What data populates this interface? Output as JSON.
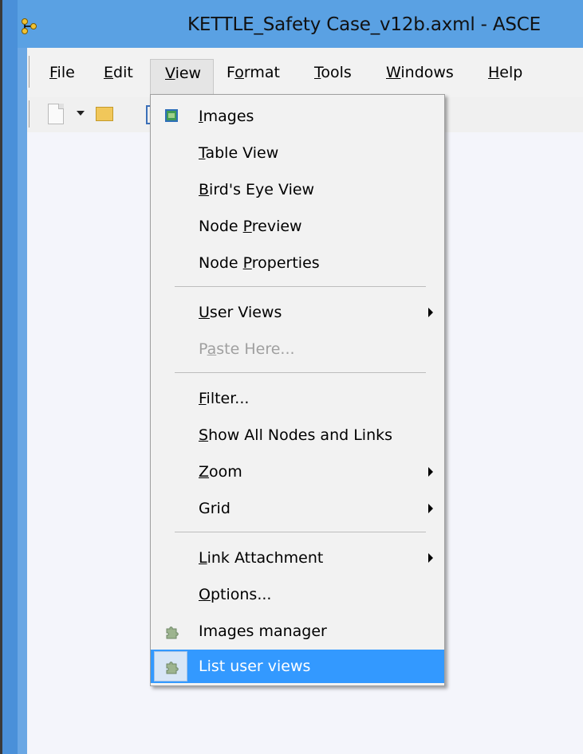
{
  "window": {
    "title": "KETTLE_Safety Case_v12b.axml - ASCE"
  },
  "menubar": {
    "items": [
      {
        "label": "File",
        "underline": "F",
        "rest": "ile"
      },
      {
        "label": "Edit",
        "underline": "E",
        "rest": "dit"
      },
      {
        "label": "View",
        "underline": "V",
        "rest": "iew",
        "active": true
      },
      {
        "label": "Format",
        "before": "F",
        "underline": "o",
        "rest": "rmat"
      },
      {
        "label": "Tools",
        "underline": "T",
        "rest": "ools"
      },
      {
        "label": "Windows",
        "underline": "W",
        "rest": "indows"
      },
      {
        "label": "Help",
        "underline": "H",
        "rest": "elp"
      }
    ]
  },
  "toolbar": {
    "icons": [
      "new-document-icon",
      "dropdown-arrow-icon",
      "open-folder-icon"
    ]
  },
  "view_menu": {
    "items": [
      {
        "label": "Images",
        "before": "",
        "u": "I",
        "after": "mages",
        "icon": "images-icon"
      },
      {
        "label": "Table View",
        "before": "",
        "u": "T",
        "after": "able View"
      },
      {
        "label": "Bird's Eye View",
        "before": "",
        "u": "B",
        "after": "ird's Eye View"
      },
      {
        "label": "Node Preview",
        "before": "Node ",
        "u": "P",
        "after": "review"
      },
      {
        "label": "Node Properties",
        "before": "Node ",
        "u": "P",
        "after": "roperties"
      },
      {
        "label": "User Views",
        "before": "",
        "u": "U",
        "after": "ser Views",
        "submenu": true
      },
      {
        "label": "Paste Here...",
        "before": "P",
        "u": "a",
        "after": "ste Here...",
        "disabled": true
      },
      {
        "label": "Filter...",
        "before": "",
        "u": "F",
        "after": "ilter..."
      },
      {
        "label": "Show All Nodes and Links",
        "before": "",
        "u": "S",
        "after": "how All Nodes and Links"
      },
      {
        "label": "Zoom",
        "before": "",
        "u": "Z",
        "after": "oom",
        "submenu": true
      },
      {
        "label": "Grid",
        "before": "Grid",
        "u": "",
        "after": "",
        "submenu": true
      },
      {
        "label": "Link Attachment",
        "before": "",
        "u": "L",
        "after": "ink Attachment",
        "submenu": true
      },
      {
        "label": "Options...",
        "before": "",
        "u": "O",
        "after": "ptions..."
      },
      {
        "label": "Images manager",
        "before": "Images manager",
        "u": "",
        "after": "",
        "icon": "puzzle-icon"
      },
      {
        "label": "List user views",
        "before": "List user views",
        "u": "",
        "after": "",
        "icon": "puzzle-icon",
        "highlighted": true
      }
    ]
  },
  "colors": {
    "titlebar": "#5aa1e3",
    "menu_highlight": "#3399ff",
    "menu_background": "#f2f2f2",
    "canvas": "#f4f5fb"
  }
}
